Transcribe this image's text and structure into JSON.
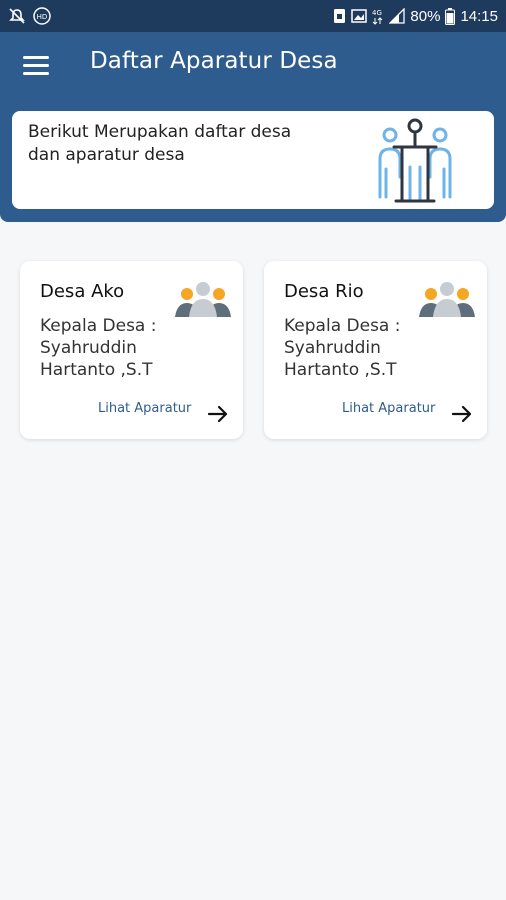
{
  "status_bar": {
    "time": "14:15",
    "battery": "80%",
    "network": "4G",
    "icons": [
      "notification-off-icon",
      "hd-icon",
      "sim-icon",
      "image-icon",
      "network-4g-icon",
      "signal-icon",
      "battery-icon"
    ]
  },
  "header": {
    "title": "Daftar Aparatur Desa",
    "menu_icon": "hamburger-menu-icon"
  },
  "info_card": {
    "text": "Berikut Merupakan daftar desa dan aparatur desa",
    "illustration": "people-organization-icon"
  },
  "villages": [
    {
      "name": "Desa Ako",
      "head_label": "Kepala Desa :",
      "head_name": "Syahruddin Hartanto ,S.T",
      "action_label": "Lihat Aparatur",
      "icon": "group-people-icon"
    },
    {
      "name": "Desa Rio",
      "head_label": "Kepala Desa :",
      "head_name": "Syahruddin Hartanto ,S.T",
      "action_label": "Lihat Aparatur",
      "icon": "group-people-icon"
    }
  ],
  "colors": {
    "primary": "#2f5c8e",
    "status_bar": "#1e3b5e",
    "accent_orange": "#f5a623",
    "icon_gray": "#5f6e7b",
    "illus_blue": "#6fb4e8"
  }
}
